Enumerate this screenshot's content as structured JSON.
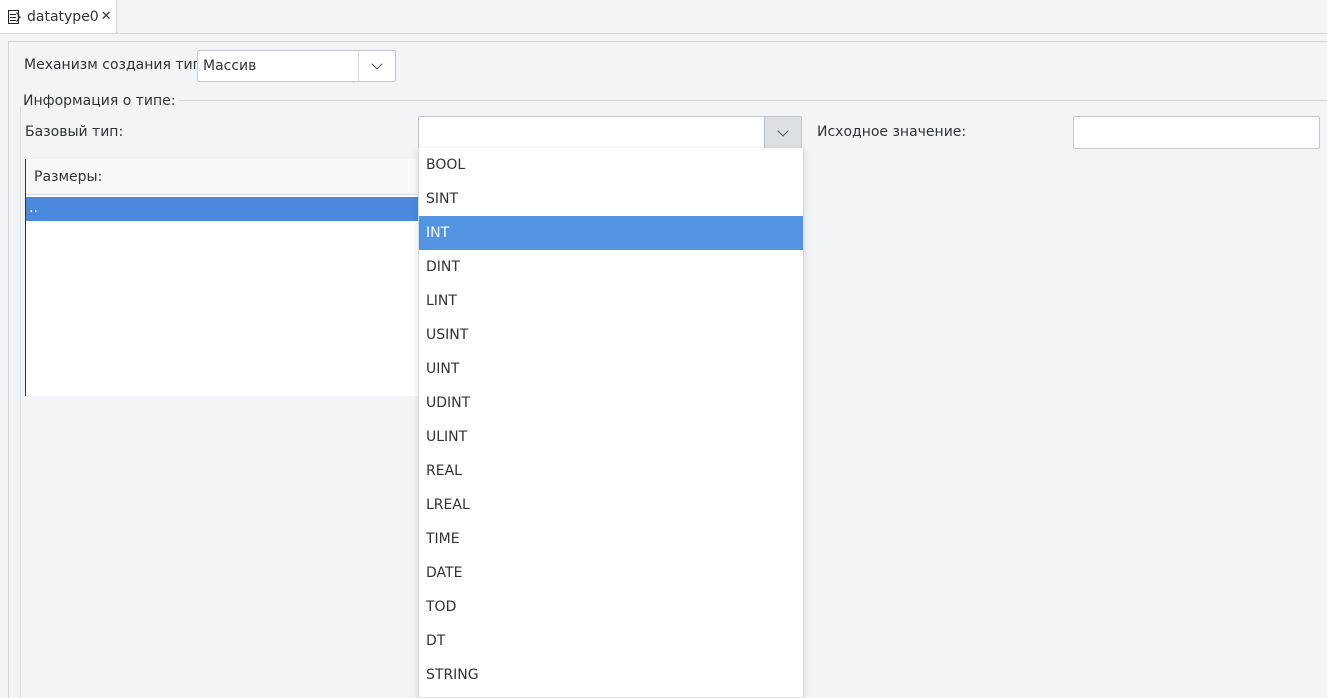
{
  "tab": {
    "title": "datatype0",
    "close": "✕"
  },
  "form": {
    "mechanism_label": "Механизм создания типа:",
    "mechanism_value": "Массив",
    "type_info_label": "Информация о типе:",
    "base_type_label": "Базовый тип:",
    "base_type_value": "",
    "initial_value_label": "Исходное значение:",
    "initial_value": ""
  },
  "sizes": {
    "header": "Размеры:",
    "rows": [
      ".."
    ]
  },
  "dropdown": {
    "options": [
      "BOOL",
      "SINT",
      "INT",
      "DINT",
      "LINT",
      "USINT",
      "UINT",
      "UDINT",
      "ULINT",
      "REAL",
      "LREAL",
      "TIME",
      "DATE",
      "TOD",
      "DT",
      "STRING"
    ],
    "selected": "INT"
  }
}
